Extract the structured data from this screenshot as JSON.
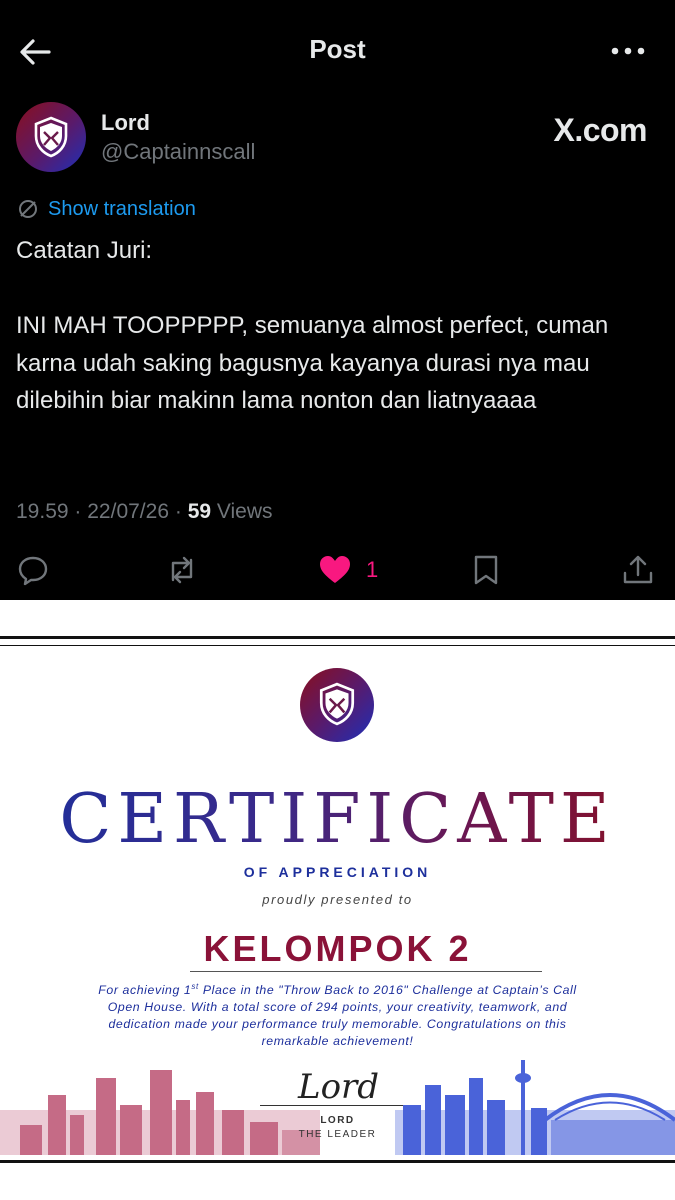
{
  "header": {
    "title": "Post",
    "back_icon": "arrow-left-icon",
    "more_icon": "more-horizontal-icon"
  },
  "author": {
    "name": "Lord",
    "handle": "@Captainnscall",
    "avatar_icon": "shield-crest-icon"
  },
  "brand": "X.com",
  "translation": {
    "label": "Show translation",
    "icon": "translate-icon"
  },
  "tweet": {
    "text": "Catatan Juri:\n\nINI MAH TOOPPPPP, semuanya almost perfect, cuman karna udah saking bagusnya kayanya durasi nya mau dilebihin biar makinn lama nonton dan liatnyaaaa"
  },
  "meta": {
    "time": "19.59",
    "separator": "·",
    "date": "22/07/26",
    "views_count": "59",
    "views_label": "Views"
  },
  "actions": {
    "reply_icon": "reply-icon",
    "repost_icon": "repost-icon",
    "like_icon": "heart-icon",
    "like_count": "1",
    "bookmark_icon": "bookmark-icon",
    "share_icon": "share-icon"
  },
  "colors": {
    "background": "#000000",
    "text": "#e7e9ea",
    "muted": "#71767b",
    "link": "#1d9bf0",
    "like": "#f91880",
    "cert_blue": "#1d2f9c",
    "cert_red": "#8b1020"
  },
  "certificate": {
    "title": "CERTIFICATE",
    "subtitle": "OF APPRECIATION",
    "presented": "proudly presented to",
    "recipient": "KELOMPOK 2",
    "body_part1": "For achieving 1",
    "body_sup": "st",
    "body_part2": " Place in the \"Throw Back to 2016\" Challenge at Captain’s Call Open House. With a total score of 294 points, your creativity, teamwork, and dedication made your performance truly memorable. Congratulations on this remarkable achievement!",
    "signature": "Lord",
    "signer_name": "LORD",
    "signer_role": "THE LEADER",
    "logo_icon": "shield-crest-icon"
  }
}
